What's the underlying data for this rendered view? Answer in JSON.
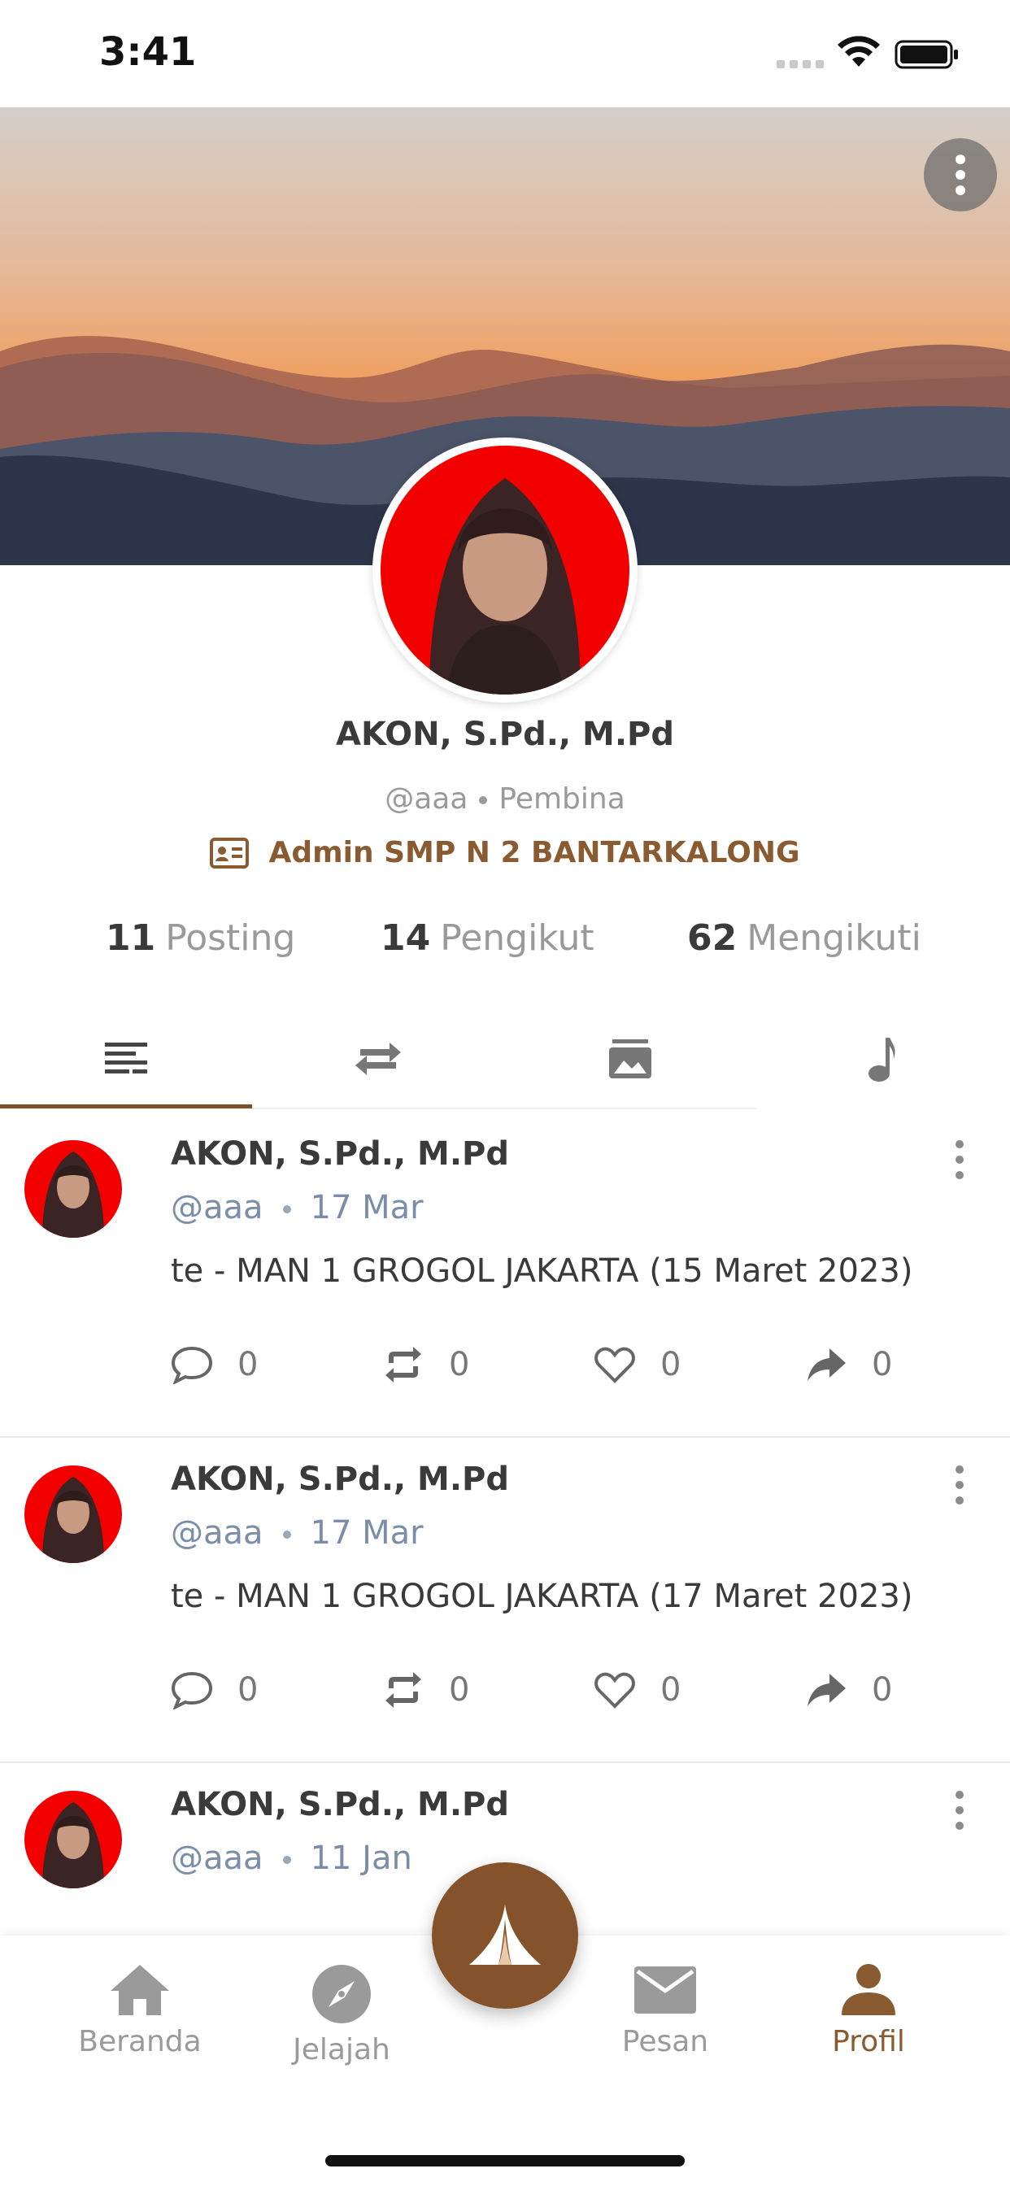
{
  "status_bar": {
    "time": "3:41"
  },
  "profile": {
    "name": "AKON, S.Pd., M.Pd",
    "handle": "@aaa",
    "role": "Pembina",
    "institution": "Admin SMP N 2 BANTARKALONG"
  },
  "stats": [
    {
      "count": "11",
      "label": "Posting"
    },
    {
      "count": "14",
      "label": "Pengikut"
    },
    {
      "count": "62",
      "label": "Mengikuti"
    }
  ],
  "tabs": [
    {
      "icon": "notes-icon",
      "active": true
    },
    {
      "icon": "repost-icon",
      "active": false
    },
    {
      "icon": "gallery-icon",
      "active": false
    },
    {
      "icon": "music-note-icon",
      "active": false
    }
  ],
  "posts": [
    {
      "name": "AKON, S.Pd., M.Pd",
      "handle": "@aaa",
      "date": "17 Mar",
      "text": "te - MAN 1 GROGOL JAKARTA (15 Maret 2023)",
      "comments": "0",
      "reposts": "0",
      "likes": "0",
      "shares": "0"
    },
    {
      "name": "AKON, S.Pd., M.Pd",
      "handle": "@aaa",
      "date": "17 Mar",
      "text": "te - MAN 1 GROGOL JAKARTA (17 Maret 2023)",
      "comments": "0",
      "reposts": "0",
      "likes": "0",
      "shares": "0"
    },
    {
      "name": "AKON, S.Pd., M.Pd",
      "handle": "@aaa",
      "date": "11 Jan"
    }
  ],
  "bottom_nav": [
    {
      "label": "Beranda",
      "icon": "home-icon"
    },
    {
      "label": "Jelajah",
      "icon": "compass-icon"
    },
    {
      "label": "Pesan",
      "icon": "mail-icon"
    },
    {
      "label": "Profil",
      "icon": "person-icon",
      "active": true
    }
  ],
  "colors": {
    "accent": "#8a5a30",
    "fab": "#85532b"
  }
}
